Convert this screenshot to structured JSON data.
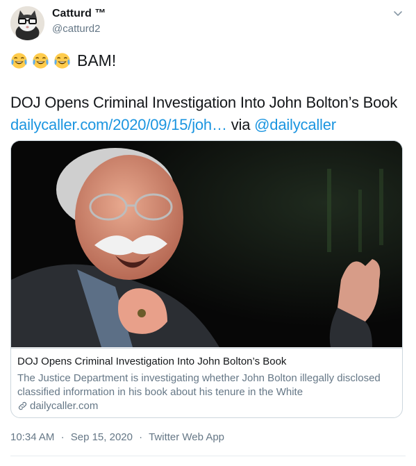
{
  "author": {
    "display_name": "Catturd ™",
    "handle": "@catturd2"
  },
  "tweet": {
    "emojis": [
      "face-with-tears-of-joy-icon",
      "face-with-tears-of-joy-icon",
      "face-with-tears-of-joy-icon"
    ],
    "text": "BAM!",
    "headline": "DOJ Opens Criminal Investigation Into John Bolton’s Book",
    "link_text": "dailycaller.com/2020/09/15/joh…",
    "via_text": "via",
    "via_handle": "@dailycaller"
  },
  "card": {
    "title": "DOJ Opens Criminal Investigation Into John Bolton’s Book",
    "description": "The Justice Department is investigating whether John Bolton illegally disclosed classified information in his book about his tenure in the White",
    "domain": "dailycaller.com"
  },
  "meta": {
    "time": "10:34 AM",
    "separator": "·",
    "date": "Sep 15, 2020",
    "source": "Twitter Web App"
  },
  "colors": {
    "link": "#1b95e0",
    "secondary_text": "#657786",
    "border": "#ccd6dd"
  }
}
